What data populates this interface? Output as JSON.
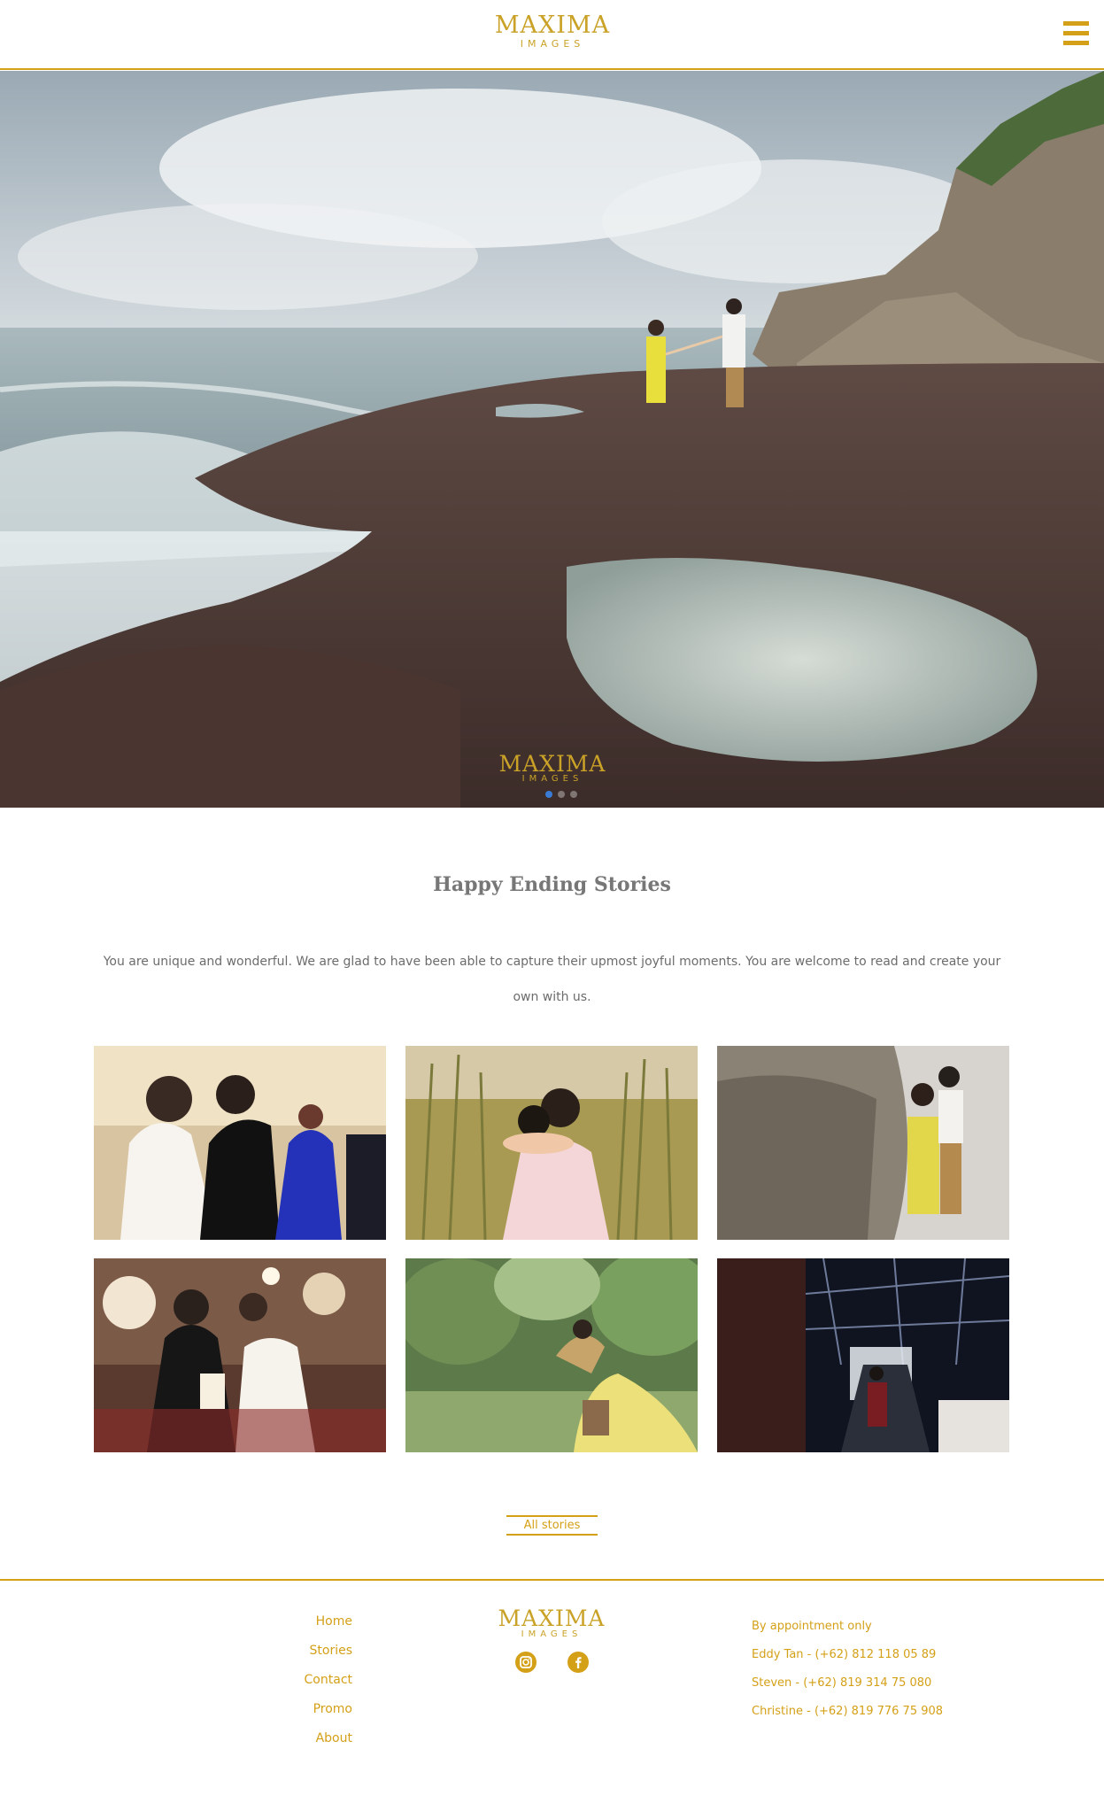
{
  "brand": {
    "logo_word": "MAXIMA",
    "logo_sub": "IMAGES"
  },
  "header": {
    "menu_icon": "hamburger-icon"
  },
  "hero": {
    "slides": 3,
    "active_slide": 1,
    "watermark": "MAXIMA",
    "watermark_sub": "IMAGES"
  },
  "stories": {
    "title": "Happy Ending Stories",
    "intro": "You are unique and wonderful. We are glad to have been able to capture their upmost joyful moments. You are welcome to read and create your own with us.",
    "button_label": "All stories"
  },
  "footer": {
    "nav": [
      "Home",
      "Stories",
      "Contact",
      "Promo",
      "About"
    ],
    "social": [
      "instagram-icon",
      "facebook-icon"
    ],
    "contact": [
      "By appointment only",
      "Eddy Tan - (+62) 812 118 05 89",
      "Steven - (+62) 819 314 75 080",
      "Christine - (+62) 819 776 75 908"
    ]
  },
  "colors": {
    "accent": "#d4a017",
    "text": "#666666"
  }
}
